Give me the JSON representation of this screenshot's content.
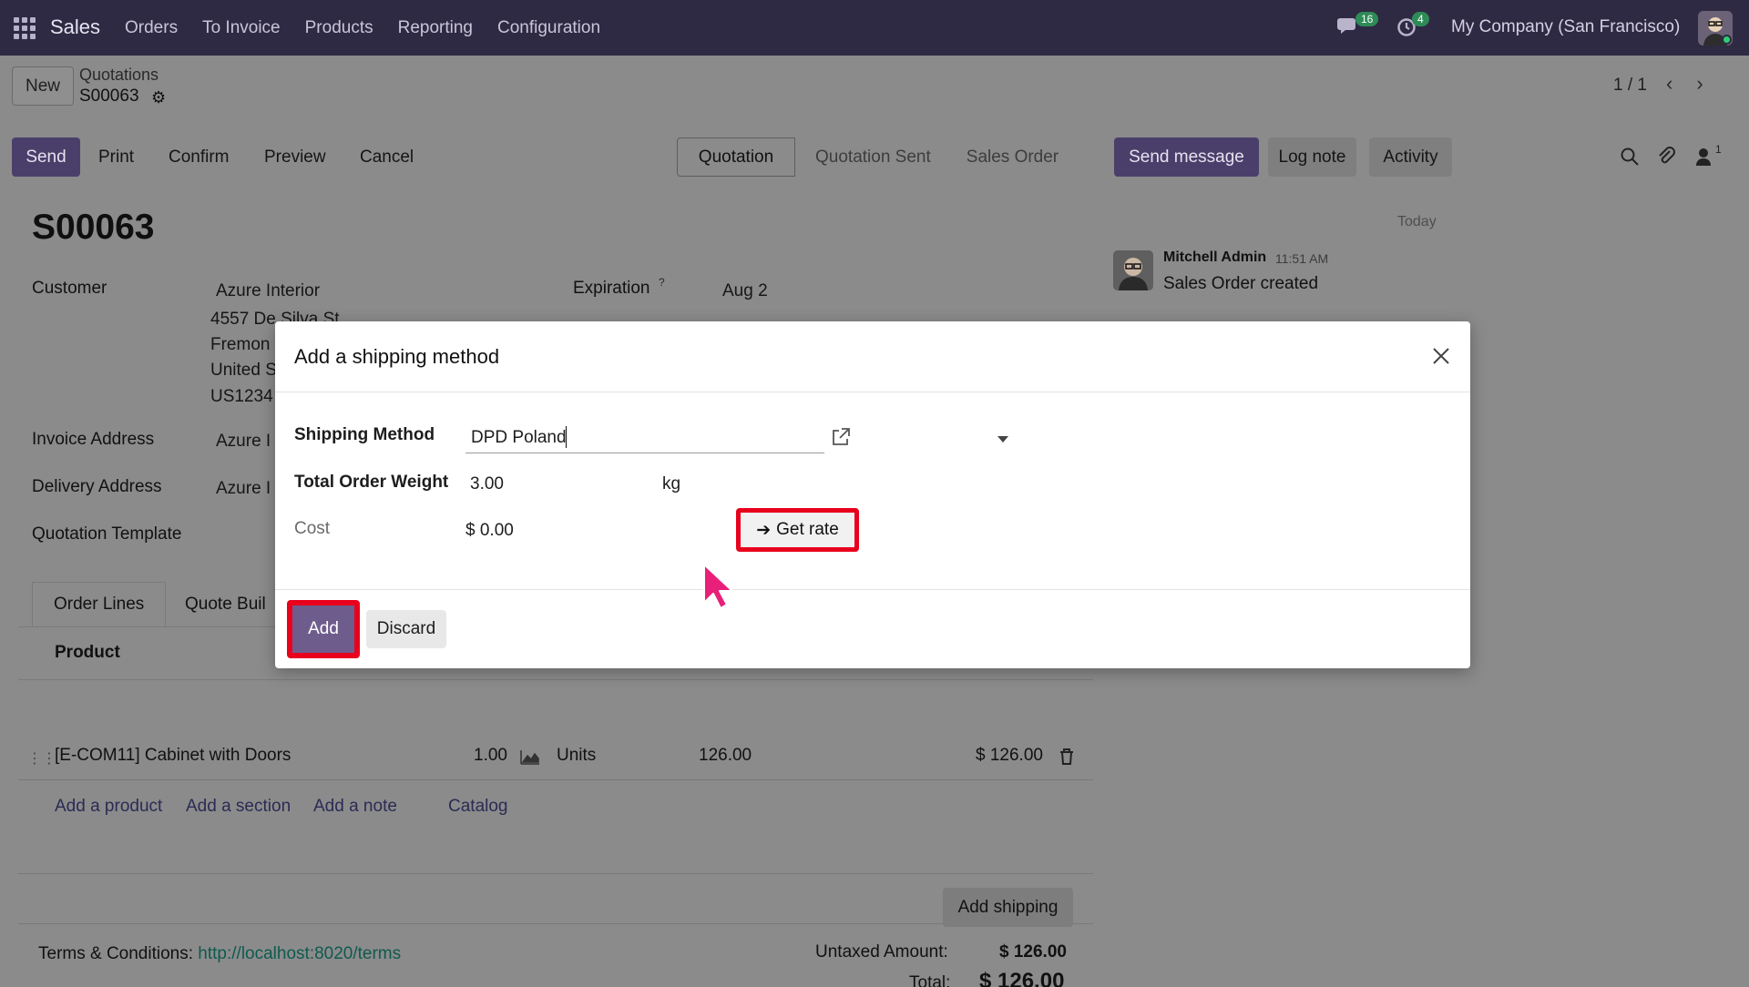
{
  "navbar": {
    "app_name": "Sales",
    "menu": [
      "Orders",
      "To Invoice",
      "Products",
      "Reporting",
      "Configuration"
    ],
    "messages_count": "16",
    "activities_count": "4",
    "company": "My Company (San Francisco)"
  },
  "control_panel": {
    "new_label": "New",
    "breadcrumb_parent": "Quotations",
    "breadcrumb_current": "S00063",
    "pager": "1 / 1"
  },
  "actions": {
    "send": "Send",
    "print": "Print",
    "confirm": "Confirm",
    "preview": "Preview",
    "cancel": "Cancel"
  },
  "statusbar": [
    "Quotation",
    "Quotation Sent",
    "Sales Order"
  ],
  "chatter": {
    "send_message": "Send message",
    "log_note": "Log note",
    "activity": "Activity",
    "followers_count": "1",
    "date_label": "Today",
    "author": "Mitchell Admin",
    "time": "11:51 AM",
    "message": "Sales Order created"
  },
  "form": {
    "title": "S00063",
    "customer_label": "Customer",
    "customer_name": "Azure Interior",
    "address_lines": [
      "4557 De Silva St",
      "Fremon",
      "United S",
      "US1234"
    ],
    "expiration_label": "Expiration",
    "expiration_help": "?",
    "expiration_value": "Aug 2",
    "invoice_address_label": "Invoice Address",
    "invoice_address_value": "Azure I",
    "delivery_address_label": "Delivery Address",
    "delivery_address_value": "Azure I",
    "quotation_template_label": "Quotation Template"
  },
  "tabs": [
    "Order Lines",
    "Quote Buil"
  ],
  "order_lines": {
    "column_product": "Product",
    "rows": [
      {
        "product": "[E-COM11] Cabinet with Doors",
        "quantity": "1.00",
        "uom": "Units",
        "unit_price": "126.00",
        "subtotal": "$ 126.00"
      }
    ],
    "links": [
      "Add a product",
      "Add a section",
      "Add a note",
      "Catalog"
    ]
  },
  "footer": {
    "add_shipping": "Add shipping",
    "terms_label": "Terms & Conditions:",
    "terms_link": "http://localhost:8020/terms",
    "untaxed_label": "Untaxed Amount:",
    "untaxed_value": "$ 126.00",
    "total_label": "Total:",
    "total_value": "$ 126.00"
  },
  "dialog": {
    "title": "Add a shipping method",
    "shipping_method_label": "Shipping Method",
    "shipping_method_value": "DPD Poland",
    "weight_label": "Total Order Weight",
    "weight_value": "3.00",
    "weight_unit": "kg",
    "cost_label": "Cost",
    "cost_value": "$ 0.00",
    "get_rate_label": "Get rate",
    "add_label": "Add",
    "discard_label": "Discard"
  },
  "colors": {
    "navbar_bg": "#2f2a43",
    "primary": "#6e5d8c",
    "highlight": "#e8001c",
    "cursor": "#e8207a"
  },
  "icons": [
    "apps-grid-icon",
    "chat-icon",
    "clock-icon",
    "settings-gear-icon",
    "chevron-left-icon",
    "chevron-right-icon",
    "search-icon",
    "paperclip-icon",
    "user-icon",
    "drag-handle-icon",
    "graph-icon",
    "trash-icon",
    "external-link-icon",
    "close-icon",
    "arrow-right-icon",
    "mouse-pointer-icon"
  ]
}
